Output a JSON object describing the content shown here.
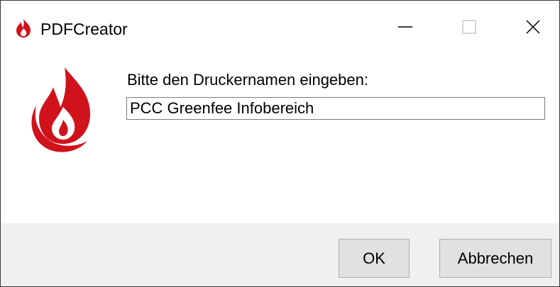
{
  "window": {
    "title": "PDFCreator",
    "icon": "pdfcreator-flame-icon",
    "controls": {
      "minimize": "minimize-icon",
      "maximize": "maximize-icon",
      "close": "close-icon"
    }
  },
  "dialog": {
    "prompt_label": "Bitte den Druckernamen eingeben:",
    "printer_name_value": "PCC Greenfee Infobereich",
    "logo": "pdfcreator-logo-icon"
  },
  "buttons": {
    "ok_label": "OK",
    "cancel_label": "Abbrechen"
  },
  "colors": {
    "brand_red": "#d0121b",
    "footer_bg": "#f0f0f0",
    "button_bg": "#e1e1e1"
  }
}
